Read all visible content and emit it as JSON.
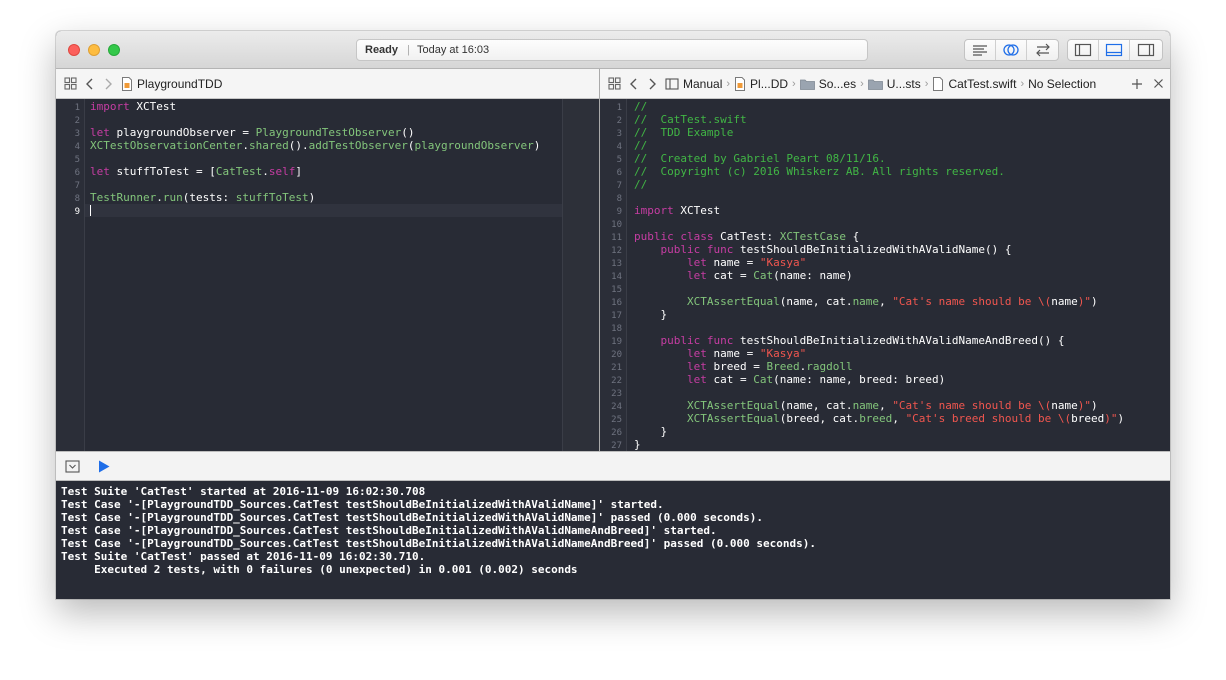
{
  "toolbar": {
    "status": "Ready",
    "separator": "|",
    "time": "Today at 16:03"
  },
  "left_jumpbar": {
    "file": "PlaygroundTDD"
  },
  "right_jumpbar": {
    "crumbs": [
      "Manual",
      "Pl...DD",
      "So...es",
      "U...sts",
      "CatTest.swift",
      "No Selection"
    ]
  },
  "left_editor": {
    "line_numbers": [
      "1",
      "2",
      "3",
      "4",
      "5",
      "6",
      "7",
      "8",
      "9"
    ],
    "lines": [
      [
        {
          "k": "k",
          "t": "import"
        },
        {
          "t": " XCTest"
        }
      ],
      [],
      [
        {
          "k": "k",
          "t": "let"
        },
        {
          "t": " playgroundObserver = "
        },
        {
          "k": "t",
          "t": "PlaygroundTestObserver"
        },
        {
          "t": "()"
        }
      ],
      [
        {
          "k": "t",
          "t": "XCTestObservationCenter"
        },
        {
          "t": "."
        },
        {
          "k": "t",
          "t": "shared"
        },
        {
          "t": "()."
        },
        {
          "k": "t",
          "t": "addTestObserver"
        },
        {
          "t": "("
        },
        {
          "k": "t",
          "t": "playgroundObserver"
        },
        {
          "t": ")"
        }
      ],
      [],
      [
        {
          "k": "k",
          "t": "let"
        },
        {
          "t": " stuffToTest = ["
        },
        {
          "k": "t",
          "t": "CatTest"
        },
        {
          "t": "."
        },
        {
          "k": "k",
          "t": "self"
        },
        {
          "t": "]"
        }
      ],
      [],
      [
        {
          "k": "t",
          "t": "TestRunner"
        },
        {
          "t": "."
        },
        {
          "k": "t",
          "t": "run"
        },
        {
          "t": "(tests: "
        },
        {
          "k": "t",
          "t": "stuffToTest"
        },
        {
          "t": ")"
        }
      ],
      []
    ]
  },
  "right_editor": {
    "line_numbers": [
      "1",
      "2",
      "3",
      "4",
      "5",
      "6",
      "7",
      "8",
      "9",
      "10",
      "11",
      "12",
      "13",
      "14",
      "15",
      "16",
      "17",
      "18",
      "19",
      "20",
      "21",
      "22",
      "23",
      "24",
      "25",
      "26",
      "27"
    ],
    "lines": [
      [
        {
          "k": "c",
          "t": "//"
        }
      ],
      [
        {
          "k": "c",
          "t": "//  CatTest.swift"
        }
      ],
      [
        {
          "k": "c",
          "t": "//  TDD Example"
        }
      ],
      [
        {
          "k": "c",
          "t": "//"
        }
      ],
      [
        {
          "k": "c",
          "t": "//  Created by Gabriel Peart 08/11/16."
        }
      ],
      [
        {
          "k": "c",
          "t": "//  Copyright (c) 2016 Whiskerz AB. All rights reserved."
        }
      ],
      [
        {
          "k": "c",
          "t": "//"
        }
      ],
      [],
      [
        {
          "k": "k",
          "t": "import"
        },
        {
          "t": " XCTest"
        }
      ],
      [],
      [
        {
          "k": "k",
          "t": "public"
        },
        {
          "t": " "
        },
        {
          "k": "k",
          "t": "class"
        },
        {
          "t": " CatTest: "
        },
        {
          "k": "t",
          "t": "XCTestCase"
        },
        {
          "t": " {"
        }
      ],
      [
        {
          "t": "    "
        },
        {
          "k": "k",
          "t": "public"
        },
        {
          "t": " "
        },
        {
          "k": "k",
          "t": "func"
        },
        {
          "t": " testShouldBeInitializedWithAValidName() {"
        }
      ],
      [
        {
          "t": "        "
        },
        {
          "k": "k",
          "t": "let"
        },
        {
          "t": " name = "
        },
        {
          "k": "s",
          "t": "\"Kasya\""
        }
      ],
      [
        {
          "t": "        "
        },
        {
          "k": "k",
          "t": "let"
        },
        {
          "t": " cat = "
        },
        {
          "k": "t",
          "t": "Cat"
        },
        {
          "t": "(name: name)"
        }
      ],
      [],
      [
        {
          "t": "        "
        },
        {
          "k": "t",
          "t": "XCTAssertEqual"
        },
        {
          "t": "(name, cat."
        },
        {
          "k": "t",
          "t": "name"
        },
        {
          "t": ", "
        },
        {
          "k": "s",
          "t": "\"Cat's name should be \\("
        },
        {
          "t": "name"
        },
        {
          "k": "s",
          "t": ")\""
        },
        {
          "t": ")"
        }
      ],
      [
        {
          "t": "    }"
        }
      ],
      [],
      [
        {
          "t": "    "
        },
        {
          "k": "k",
          "t": "public"
        },
        {
          "t": " "
        },
        {
          "k": "k",
          "t": "func"
        },
        {
          "t": " testShouldBeInitializedWithAValidNameAndBreed() {"
        }
      ],
      [
        {
          "t": "        "
        },
        {
          "k": "k",
          "t": "let"
        },
        {
          "t": " name = "
        },
        {
          "k": "s",
          "t": "\"Kasya\""
        }
      ],
      [
        {
          "t": "        "
        },
        {
          "k": "k",
          "t": "let"
        },
        {
          "t": " breed = "
        },
        {
          "k": "t",
          "t": "Breed"
        },
        {
          "t": "."
        },
        {
          "k": "t",
          "t": "ragdoll"
        }
      ],
      [
        {
          "t": "        "
        },
        {
          "k": "k",
          "t": "let"
        },
        {
          "t": " cat = "
        },
        {
          "k": "t",
          "t": "Cat"
        },
        {
          "t": "(name: name, breed: breed)"
        }
      ],
      [],
      [
        {
          "t": "        "
        },
        {
          "k": "t",
          "t": "XCTAssertEqual"
        },
        {
          "t": "(name, cat."
        },
        {
          "k": "t",
          "t": "name"
        },
        {
          "t": ", "
        },
        {
          "k": "s",
          "t": "\"Cat's name should be \\("
        },
        {
          "t": "name"
        },
        {
          "k": "s",
          "t": ")\""
        },
        {
          "t": ")"
        }
      ],
      [
        {
          "t": "        "
        },
        {
          "k": "t",
          "t": "XCTAssertEqual"
        },
        {
          "t": "(breed, cat."
        },
        {
          "k": "t",
          "t": "breed"
        },
        {
          "t": ", "
        },
        {
          "k": "s",
          "t": "\"Cat's breed should be \\("
        },
        {
          "t": "breed"
        },
        {
          "k": "s",
          "t": ")\""
        },
        {
          "t": ")"
        }
      ],
      [
        {
          "t": "    }"
        }
      ],
      [
        {
          "t": "}"
        }
      ]
    ]
  },
  "console": {
    "lines": [
      "Test Suite 'CatTest' started at 2016-11-09 16:02:30.708",
      "Test Case '-[PlaygroundTDD_Sources.CatTest testShouldBeInitializedWithAValidName]' started.",
      "Test Case '-[PlaygroundTDD_Sources.CatTest testShouldBeInitializedWithAValidName]' passed (0.000 seconds).",
      "Test Case '-[PlaygroundTDD_Sources.CatTest testShouldBeInitializedWithAValidNameAndBreed]' started.",
      "Test Case '-[PlaygroundTDD_Sources.CatTest testShouldBeInitializedWithAValidNameAndBreed]' passed (0.000 seconds).",
      "Test Suite 'CatTest' passed at 2016-11-09 16:02:30.710.",
      "     Executed 2 tests, with 0 failures (0 unexpected) in 0.001 (0.002) seconds"
    ]
  },
  "icons": {
    "window_controls": [
      "close-icon",
      "minimize-icon",
      "zoom-icon"
    ],
    "editor_mode": [
      "standard-editor-icon",
      "assistant-editor-icon",
      "version-editor-icon"
    ],
    "panels": [
      "navigator-toggle-icon",
      "debug-area-toggle-icon",
      "utilities-toggle-icon"
    ],
    "debug": [
      "hide-debug-area-icon",
      "run-playground-icon"
    ]
  },
  "colors": {
    "editor_bg": "#282b35",
    "keyword": "#c63da3",
    "type": "#83c57b",
    "comment": "#41b645",
    "string": "#f0564f",
    "accent": "#1f6ee8"
  }
}
